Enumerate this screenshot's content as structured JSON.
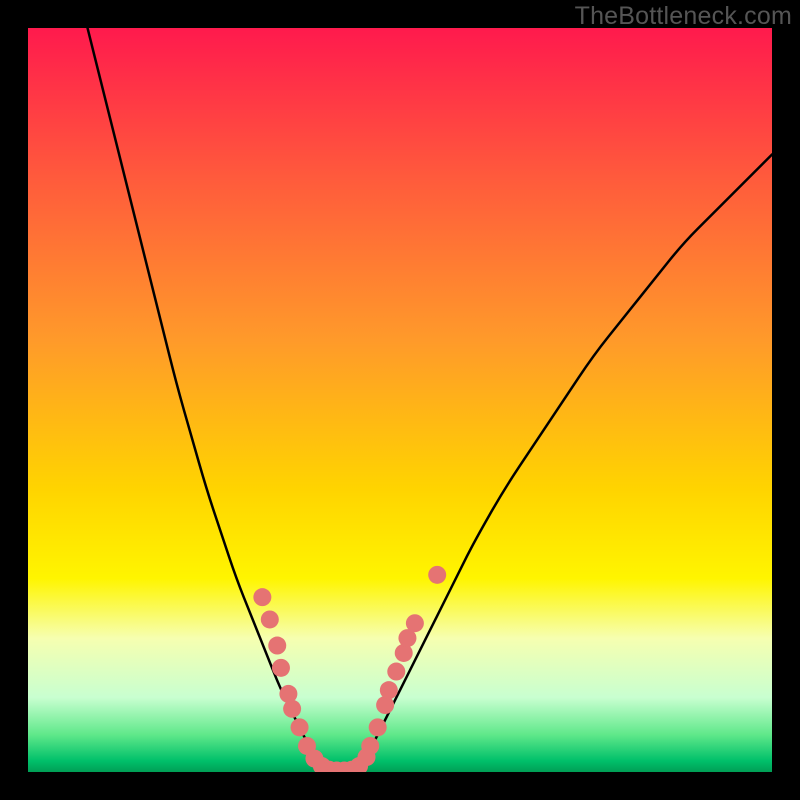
{
  "watermark": "TheBottleneck.com",
  "palette": {
    "frame": "#000000",
    "gradient_stops": [
      {
        "offset": 0.0,
        "color": "#ff1a4d"
      },
      {
        "offset": 0.2,
        "color": "#ff5a3c"
      },
      {
        "offset": 0.42,
        "color": "#ff9a2a"
      },
      {
        "offset": 0.62,
        "color": "#ffd400"
      },
      {
        "offset": 0.74,
        "color": "#fff500"
      },
      {
        "offset": 0.82,
        "color": "#f6ffb0"
      },
      {
        "offset": 0.9,
        "color": "#c8ffd0"
      },
      {
        "offset": 0.95,
        "color": "#5fe88a"
      },
      {
        "offset": 0.985,
        "color": "#00c06a"
      },
      {
        "offset": 1.0,
        "color": "#009e55"
      }
    ],
    "curve_stroke": "#000000",
    "marker_fill": "#e57373"
  },
  "chart_data": {
    "type": "line",
    "title": "",
    "xlabel": "",
    "ylabel": "",
    "xlim": [
      0,
      100
    ],
    "ylim": [
      0,
      100
    ],
    "grid": false,
    "legend": false,
    "description": "V-shaped bottleneck curve. The vertical axis is percent bottleneck (0% at bottom / green band, 100% at top / red). The horizontal axis is relative component balance. Minimum (optimal balance) occurs near x ≈ 40–44 where the curve touches 0%. Pink markers indicate sampled configurations clustering around the optimum.",
    "series": [
      {
        "name": "left-branch",
        "x": [
          8,
          10,
          12,
          14,
          16,
          18,
          20,
          22,
          24,
          26,
          28,
          30,
          32,
          34,
          36,
          38,
          40
        ],
        "values": [
          100,
          92,
          84,
          76,
          68,
          60,
          52,
          45,
          38,
          32,
          26,
          21,
          16,
          11,
          7,
          3,
          0
        ]
      },
      {
        "name": "right-branch",
        "x": [
          44,
          46,
          48,
          50,
          52,
          54,
          56,
          58,
          60,
          64,
          68,
          72,
          76,
          80,
          84,
          88,
          92,
          96,
          100
        ],
        "values": [
          0,
          3,
          7,
          11,
          15,
          19,
          23,
          27,
          31,
          38,
          44,
          50,
          56,
          61,
          66,
          71,
          75,
          79,
          83
        ]
      }
    ],
    "markers": [
      {
        "x": 31.5,
        "y": 23.5
      },
      {
        "x": 32.5,
        "y": 20.5
      },
      {
        "x": 33.5,
        "y": 17.0
      },
      {
        "x": 34.0,
        "y": 14.0
      },
      {
        "x": 35.0,
        "y": 10.5
      },
      {
        "x": 35.5,
        "y": 8.5
      },
      {
        "x": 36.5,
        "y": 6.0
      },
      {
        "x": 37.5,
        "y": 3.5
      },
      {
        "x": 38.5,
        "y": 1.8
      },
      {
        "x": 39.5,
        "y": 0.8
      },
      {
        "x": 40.5,
        "y": 0.3
      },
      {
        "x": 41.5,
        "y": 0.2
      },
      {
        "x": 42.5,
        "y": 0.2
      },
      {
        "x": 43.5,
        "y": 0.3
      },
      {
        "x": 44.5,
        "y": 0.8
      },
      {
        "x": 45.5,
        "y": 2.0
      },
      {
        "x": 46.0,
        "y": 3.5
      },
      {
        "x": 47.0,
        "y": 6.0
      },
      {
        "x": 48.0,
        "y": 9.0
      },
      {
        "x": 48.5,
        "y": 11.0
      },
      {
        "x": 49.5,
        "y": 13.5
      },
      {
        "x": 50.5,
        "y": 16.0
      },
      {
        "x": 51.0,
        "y": 18.0
      },
      {
        "x": 52.0,
        "y": 20.0
      },
      {
        "x": 55.0,
        "y": 26.5
      }
    ]
  }
}
